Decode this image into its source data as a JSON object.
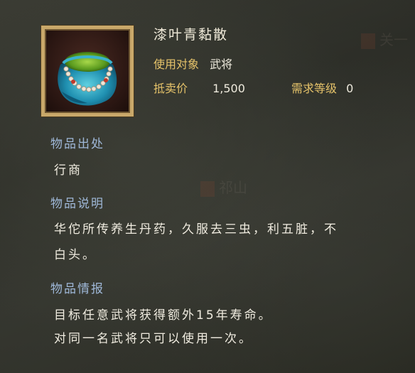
{
  "item": {
    "name": "漆叶青黏散",
    "target_label": "使用对象",
    "target_value": "武将",
    "price_label": "抵卖价",
    "price_value": "1,500",
    "level_label": "需求等级",
    "level_value": "0"
  },
  "sections": {
    "source": {
      "heading": "物品出处",
      "text": "行商"
    },
    "description": {
      "heading": "物品说明",
      "line1": "华佗所传养生丹药，久服去三虫，利五脏，不",
      "line2": "白头。"
    },
    "info": {
      "heading": "物品情报",
      "line1": "目标任意武将获得额外15年寿命。",
      "line2": "对同一名武将只可以使用一次。"
    }
  },
  "background_labels": {
    "top_right": "关一",
    "middle": "祁山"
  },
  "colors": {
    "title": "#efe9d8",
    "field_label": "#e6c36a",
    "section_heading": "#9fb8d8",
    "body_text": "#f0ece0",
    "frame": "#c9a86a"
  },
  "icons": {
    "item_icon": "medicine-pouch-icon"
  }
}
